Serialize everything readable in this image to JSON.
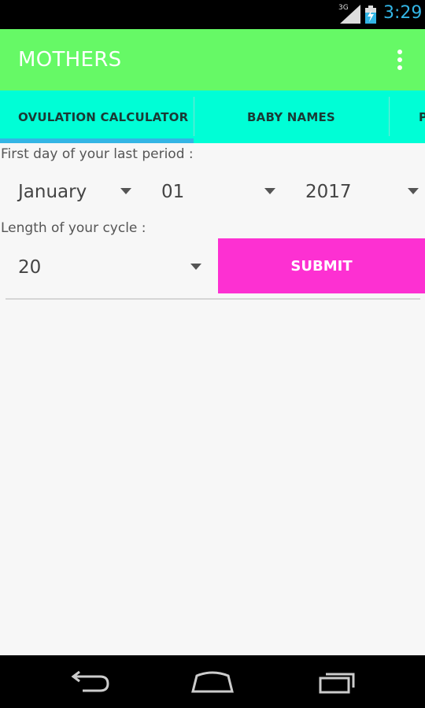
{
  "status_bar": {
    "network": "3G",
    "time": "3:29",
    "signal_icon": "signal-icon",
    "battery_icon": "battery-charging-icon"
  },
  "app_bar": {
    "title": "MOTHERS",
    "menu_icon": "overflow-menu-icon"
  },
  "tabs": [
    {
      "label": "OVULATION CALCULATOR",
      "selected": true
    },
    {
      "label": "BABY NAMES",
      "selected": false
    },
    {
      "label": "P",
      "selected": false
    }
  ],
  "form": {
    "period_label": "First day of your last period :",
    "month": "January",
    "day": "01",
    "year": "2017",
    "cycle_label": "Length of your cycle :",
    "cycle_length": "20",
    "submit_label": "SUBMIT"
  },
  "nav_bar": {
    "back_icon": "back-icon",
    "home_icon": "home-icon",
    "recents_icon": "recent-apps-icon"
  },
  "colors": {
    "app_bar": "#66f966",
    "tabs": "#00fed6",
    "tab_indicator": "#33b5e5",
    "submit": "#fd30d2"
  }
}
